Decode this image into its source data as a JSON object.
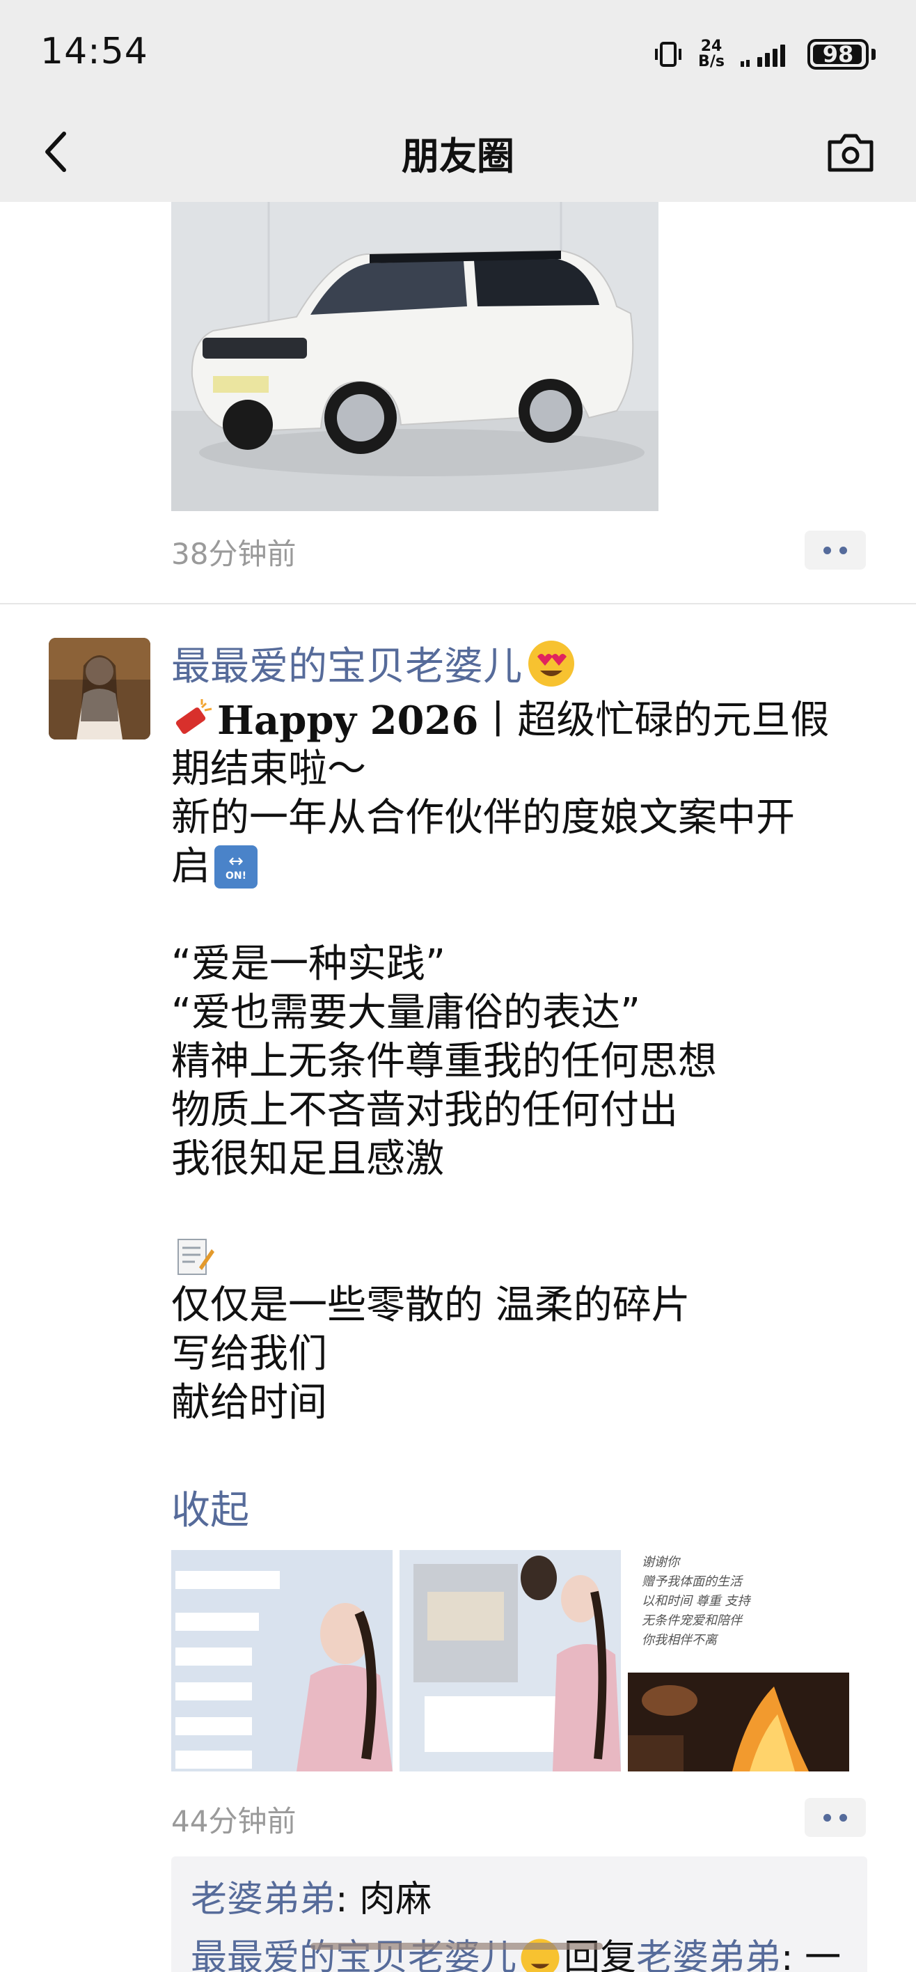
{
  "status_bar": {
    "time": "14:54",
    "net_speed_value": "24",
    "net_speed_unit": "B/s",
    "battery": "98",
    "battery_level": 0.98
  },
  "nav": {
    "title": "朋友圈",
    "back_icon": "chevron-left-icon",
    "camera_icon": "camera-icon"
  },
  "previous_post": {
    "time": "38分钟前"
  },
  "post": {
    "author": "最最爱的宝贝老婆儿",
    "author_emoji": "😍",
    "lines": {
      "l1_happy": "Happy 2026",
      "l1_rest": "丨超级忙碌的元旦假",
      "l2": "期结束啦～",
      "l3": "新的一年从合作伙伴的度娘文案中开",
      "l4": "启",
      "l5": "“爱是一种实践”",
      "l6": "“爱也需要大量庸俗的表达”",
      "l7": "精神上无条件尊重我的任何思想",
      "l8": "物质上不吝啬对我的任何付出",
      "l9": "我很知足且感激",
      "l10": "仅仅是一些零散的 温柔的碎片",
      "l11": "写给我们",
      "l12": "献给时间"
    },
    "on_badge": "ON!",
    "collapse": "收起",
    "photo3_caption": {
      "l1": "谢谢你",
      "l2": "赠予我体面的生活",
      "l3": "以和时间 尊重 支持",
      "l4": "无条件宠爱和陪伴",
      "l5": "你我相伴不离"
    },
    "time": "44分钟前"
  },
  "comments": {
    "c1_name": "老婆弟弟",
    "c1_text": ": 肉麻",
    "c2_name": "最最爱的宝贝老婆儿",
    "c2_reply": "回复",
    "c2_target": "老婆弟弟",
    "c2_text": ": 一"
  },
  "colors": {
    "link": "#566b9a",
    "header_bg": "#ededed",
    "time_gray": "#9a9a9a"
  }
}
